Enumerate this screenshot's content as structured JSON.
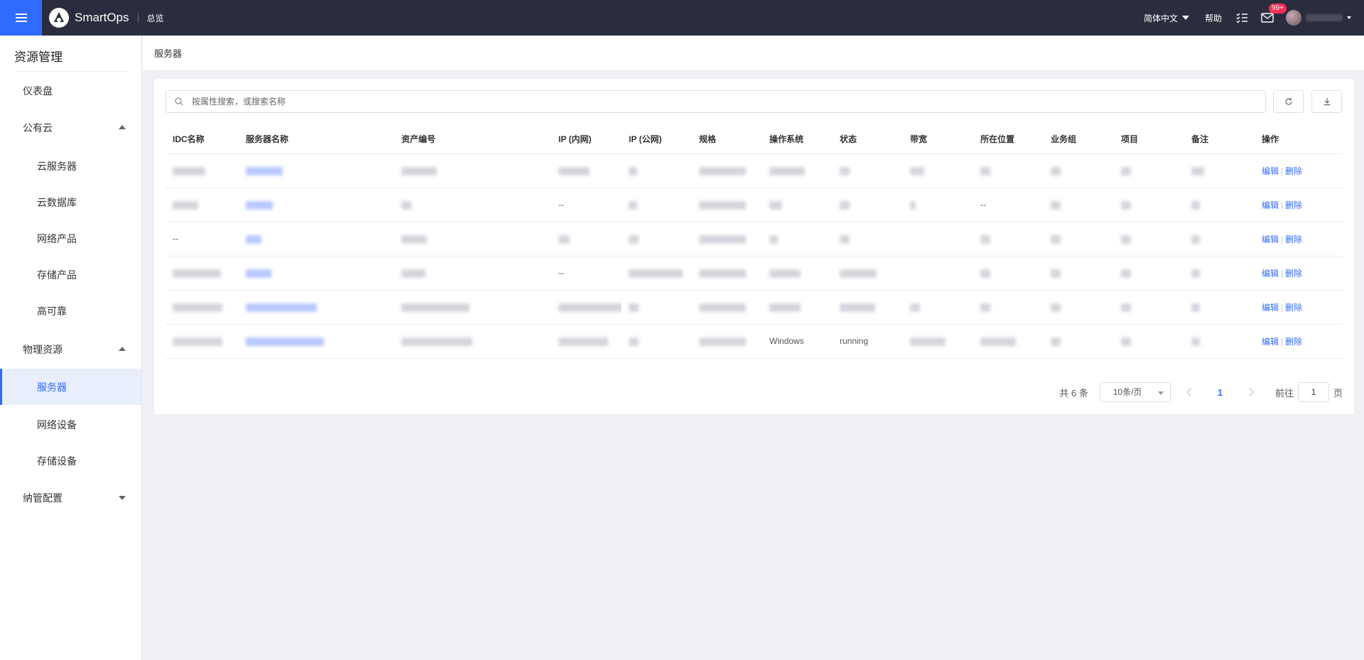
{
  "topbar": {
    "app_name": "SmartOps",
    "nav_overview": "总览",
    "language": "简体中文",
    "help": "帮助",
    "notifications_badge": "99+",
    "accent_color": "#2f6bff"
  },
  "sidebar": {
    "title": "资源管理",
    "items": [
      {
        "label": "仪表盘"
      },
      {
        "label": "公有云"
      },
      {
        "label": "云服务器"
      },
      {
        "label": "云数据库"
      },
      {
        "label": "网络产品"
      },
      {
        "label": "存储产品"
      },
      {
        "label": "高可靠"
      },
      {
        "label": "物理资源"
      },
      {
        "label": "服务器"
      },
      {
        "label": "网络设备"
      },
      {
        "label": "存储设备"
      },
      {
        "label": "纳管配置"
      }
    ]
  },
  "breadcrumb": {
    "current": "服务器"
  },
  "search": {
    "placeholder": "按属性搜索，或搜索名称"
  },
  "table": {
    "columns": [
      "IDC名称",
      "服务器名称",
      "资产编号",
      "IP (内网)",
      "IP (公网)",
      "规格",
      "操作系统",
      "状态",
      "带宽",
      "所在位置",
      "业务组",
      "项目",
      "备注",
      "操作"
    ],
    "rows": [
      {
        "idc": "",
        "name": "",
        "asset": "",
        "ip_in": "",
        "ip_out": "",
        "spec": "",
        "os": "",
        "status": "",
        "bw": "",
        "loc": "",
        "group": "",
        "proj": "",
        "remark": ""
      },
      {
        "idc": "",
        "name": "",
        "asset": "",
        "ip_in": "--",
        "ip_out": "",
        "spec": "",
        "os": "",
        "status": "",
        "bw": "",
        "loc": "--",
        "group": "",
        "proj": "",
        "remark": ""
      },
      {
        "idc": "--",
        "name": "",
        "asset": "",
        "ip_in": "",
        "ip_out": "",
        "spec": "",
        "os": "",
        "status": "",
        "bw": "",
        "loc": "",
        "group": "",
        "proj": "",
        "remark": ""
      },
      {
        "idc": "",
        "name": "",
        "asset": "",
        "ip_in": "--",
        "ip_out": "",
        "spec": "",
        "os": "",
        "status": "",
        "bw": "",
        "loc": "",
        "group": "",
        "proj": "",
        "remark": ""
      },
      {
        "idc": "",
        "name": "",
        "asset": "",
        "ip_in": "",
        "ip_out": "",
        "spec": "",
        "os": "",
        "status": "",
        "bw": "",
        "loc": "",
        "group": "",
        "proj": "",
        "remark": ""
      },
      {
        "idc": "",
        "name": "",
        "asset": "",
        "ip_in": "",
        "ip_out": "",
        "spec": "",
        "os": "Windows",
        "status": "running",
        "bw": "",
        "loc": "",
        "group": "",
        "proj": "",
        "remark": ""
      }
    ],
    "edit_label": "编辑",
    "delete_label": "删除"
  },
  "pagination": {
    "total": "共 6 条",
    "page_size": "10条/页",
    "current_page": "1",
    "goto_prefix": "前往",
    "goto_value": "1",
    "goto_suffix": "页"
  }
}
